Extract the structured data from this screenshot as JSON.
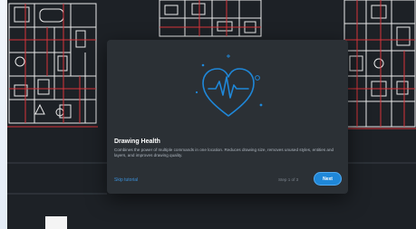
{
  "dialog": {
    "title": "Drawing Health",
    "description": "Combines the power of multiple commands in one location. Reduces drawing size, removes unused styles, entities and layers, and improves drawing quality.",
    "skip_label": "Skip tutorial",
    "step_counter": "Step 1 of 3",
    "next_label": "Next",
    "hero_icon": "heart-pulse-icon"
  },
  "colors": {
    "canvas": "#1d2126",
    "dialog": "#2b3035",
    "accent": "#1f87d8",
    "walls": "#f2f2f2",
    "red_lines": "#d8343a"
  }
}
